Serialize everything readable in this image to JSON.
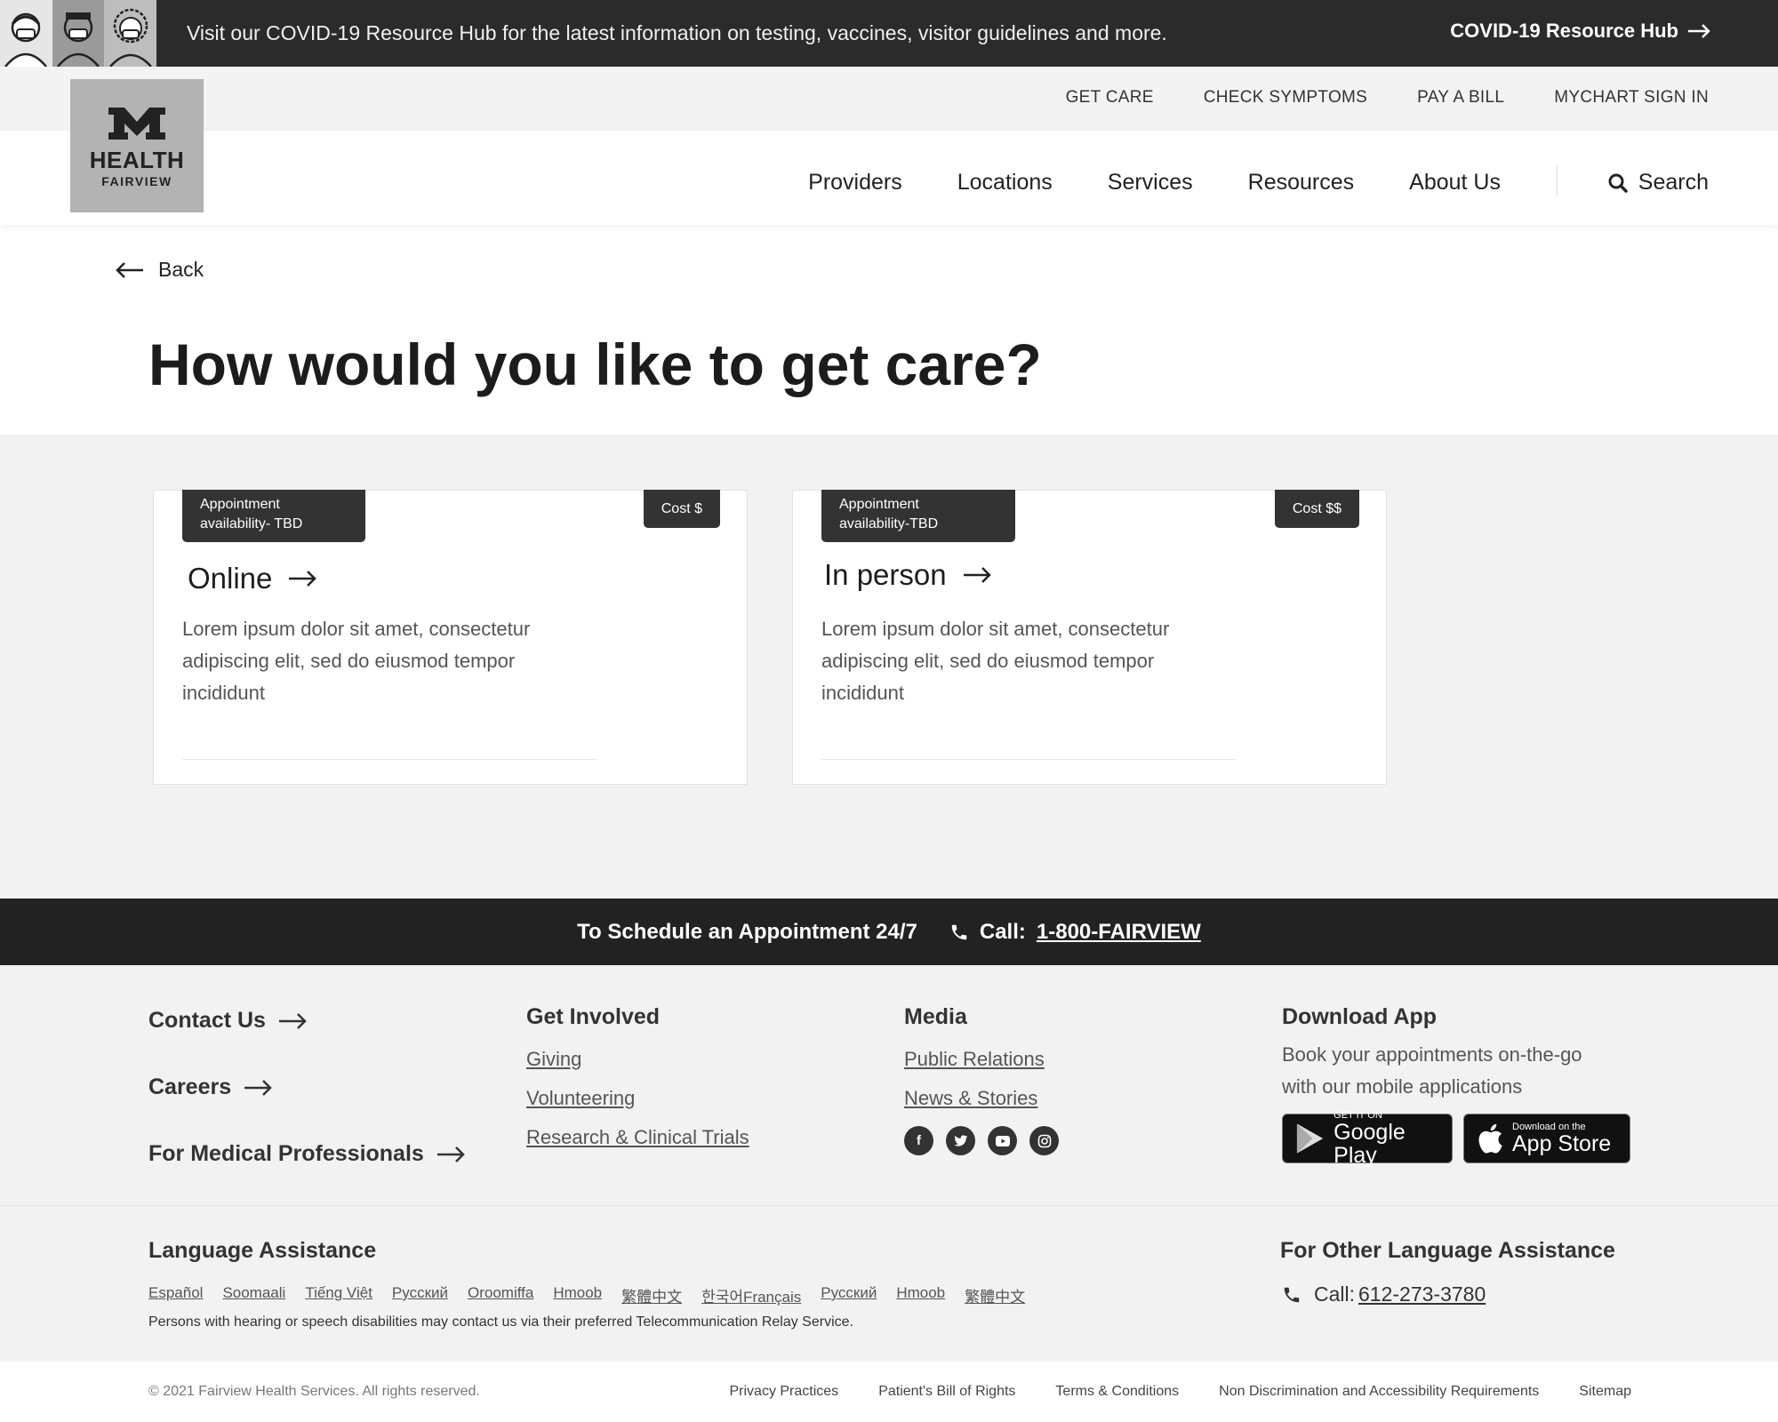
{
  "covid": {
    "message": "Visit our COVID-19 Resource Hub for the latest information on testing, vaccines, visitor guidelines and more.",
    "link": "COVID-19 Resource Hub"
  },
  "util_nav": [
    "GET CARE",
    "CHECK SYMPTOMS",
    "PAY A BILL",
    "MYCHART SIGN IN"
  ],
  "logo": {
    "line1": "HEALTH",
    "line2": "FAIRVIEW"
  },
  "main_nav": [
    "Providers",
    "Locations",
    "Services",
    "Resources",
    "About Us"
  ],
  "search_label": "Search",
  "back_label": "Back",
  "page_title": "How would you like to get care?",
  "cards": [
    {
      "availability_line1": "Appointment",
      "availability_line2": "availability- TBD",
      "cost": "Cost $",
      "title": "Online",
      "description": "Lorem ipsum dolor sit amet, consectetur adipiscing elit, sed do eiusmod tempor incididunt"
    },
    {
      "availability_line1": "Appointment",
      "availability_line2": "availability-TBD",
      "cost": "Cost $$",
      "title": "In person",
      "description": "Lorem ipsum dolor sit amet, consectetur adipiscing elit, sed do eiusmod tempor incididunt"
    }
  ],
  "schedule": {
    "label": "To Schedule an Appointment 24/7",
    "call_prefix": "Call:",
    "phone": "1-800-FAIRVIEW"
  },
  "footer": {
    "col1": [
      "Contact Us",
      "Careers",
      "For Medical Professionals"
    ],
    "get_involved": {
      "heading": "Get Involved",
      "links": [
        "Giving",
        "Volunteering",
        "Research & Clinical Trials"
      ]
    },
    "media": {
      "heading": "Media",
      "links": [
        "Public Relations",
        "News & Stories"
      ],
      "socials": [
        "facebook-icon",
        "twitter-icon",
        "youtube-icon",
        "instagram-icon"
      ]
    },
    "download": {
      "heading": "Download App",
      "text": "Book your appointments on-the-go with our mobile applications",
      "google_small": "GET IT ON",
      "google_big": "Google Play",
      "apple_small": "Download on the",
      "apple_big": "App Store"
    }
  },
  "language": {
    "heading": "Language Assistance",
    "links": [
      "Español",
      "Soomaali",
      "Tiếng Việt",
      "Русский",
      "Oroomiffa",
      "Hmoob",
      "繁體中文",
      "한국어Français",
      "Русский",
      "Hmoob",
      "繁體中文"
    ],
    "note": "Persons with hearing or speech disabilities may contact us via their preferred Telecommunication Relay Service.",
    "other_heading": "For Other Language Assistance",
    "other_call_prefix": "Call:",
    "other_phone": "612-273-3780"
  },
  "bottom": {
    "copyright": "© 2021 Fairview Health Services. All rights reserved.",
    "links": [
      "Privacy Practices",
      "Patient's Bill of Rights",
      "Terms & Conditions",
      "Non Discrimination and Accessibility Requirements",
      "Sitemap"
    ]
  }
}
